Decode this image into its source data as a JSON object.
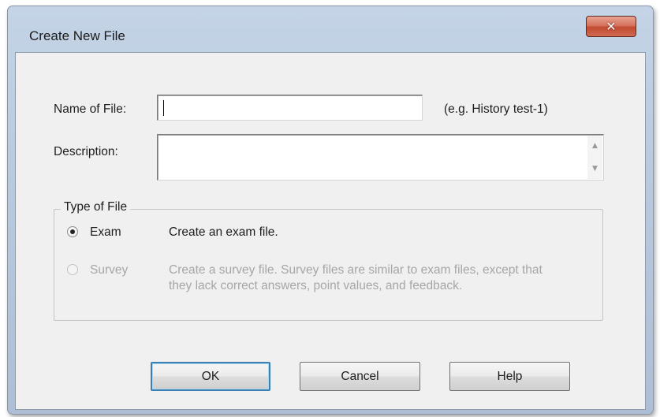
{
  "window": {
    "title": "Create New File",
    "close_glyph": "✕"
  },
  "form": {
    "name_label": "Name of File:",
    "name_value": "",
    "name_hint": "(e.g. History test-1)",
    "description_label": "Description:",
    "description_value": ""
  },
  "type_group": {
    "legend": "Type of File",
    "options": [
      {
        "label": "Exam",
        "description": "Create an exam file.",
        "checked": true,
        "enabled": true
      },
      {
        "label": "Survey",
        "description_line1": "Create a survey file.  Survey files are similar to exam files, except that",
        "description_line2": "they lack correct answers, point values, and feedback.",
        "checked": false,
        "enabled": false
      }
    ]
  },
  "buttons": {
    "ok": "OK",
    "cancel": "Cancel",
    "help": "Help"
  },
  "icons": {
    "close": "close-icon",
    "scroll_up": "chevron-up-icon",
    "scroll_down": "chevron-down-icon"
  },
  "colors": {
    "close_button": "#c24b31",
    "dialog_background": "#f0f0f0",
    "disabled_text": "#a6a6a6",
    "default_button_border": "#3c7fb1"
  }
}
